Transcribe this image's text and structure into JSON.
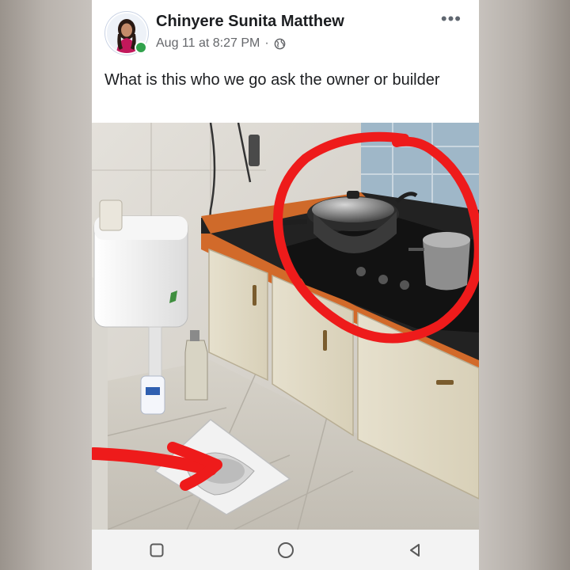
{
  "post": {
    "author": "Chinyere Sunita Matthew",
    "date": "Aug 11 at 8:27 PM",
    "separator": "·",
    "audience_icon": "globe-icon",
    "more_icon": "more-dots-icon",
    "more_label": "•••",
    "text": "What is this who we go ask the owner or builder"
  },
  "photo": {
    "annotation_color": "#ee1b1b"
  },
  "nav": {
    "icons": [
      "recent-apps-icon",
      "home-icon",
      "back-icon"
    ]
  }
}
